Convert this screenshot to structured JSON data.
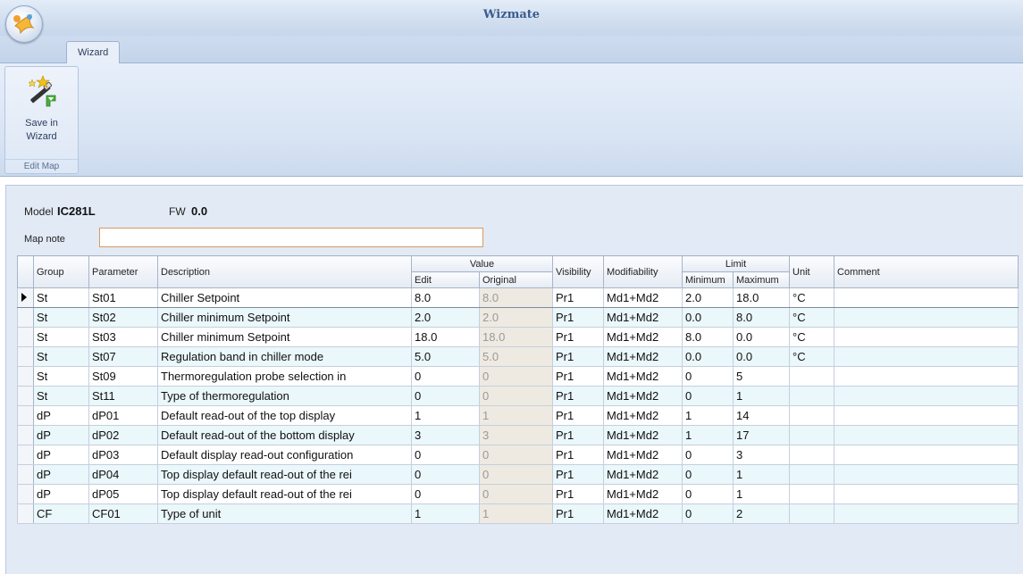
{
  "window": {
    "title": "Wizmate"
  },
  "ribbon": {
    "tabs": [
      "Wizard"
    ],
    "save_button": {
      "label_line1": "Save in",
      "label_line2": "Wizard",
      "icon": "magic-wand-icon"
    },
    "group_label": "Edit Map"
  },
  "info": {
    "model_label": "Model",
    "model_value": "IC281L",
    "fw_label": "FW",
    "fw_value": "0.0",
    "map_note_label": "Map note",
    "map_note_value": ""
  },
  "grid": {
    "headers": {
      "group": "Group",
      "parameter": "Parameter",
      "description": "Description",
      "value": "Value",
      "edit": "Edit",
      "original": "Original",
      "visibility": "Visibility",
      "modifiability": "Modifiability",
      "limit": "Limit",
      "minimum": "Minimum",
      "maximum": "Maximum",
      "unit": "Unit",
      "comment": "Comment"
    },
    "rows": [
      {
        "group": "St",
        "parameter": "St01",
        "description": "Chiller Setpoint",
        "edit": "8.0",
        "original": "8.0",
        "visibility": "Pr1",
        "modifiability": "Md1+Md2",
        "minimum": "2.0",
        "maximum": "18.0",
        "unit": "°C",
        "comment": ""
      },
      {
        "group": "St",
        "parameter": "St02",
        "description": "Chiller minimum Setpoint",
        "edit": "2.0",
        "original": "2.0",
        "visibility": "Pr1",
        "modifiability": "Md1+Md2",
        "minimum": "0.0",
        "maximum": "8.0",
        "unit": "°C",
        "comment": ""
      },
      {
        "group": "St",
        "parameter": "St03",
        "description": "Chiller minimum Setpoint",
        "edit": "18.0",
        "original": "18.0",
        "visibility": "Pr1",
        "modifiability": "Md1+Md2",
        "minimum": "8.0",
        "maximum": "0.0",
        "unit": "°C",
        "comment": ""
      },
      {
        "group": "St",
        "parameter": "St07",
        "description": "Regulation band in chiller mode",
        "edit": "5.0",
        "original": "5.0",
        "visibility": "Pr1",
        "modifiability": "Md1+Md2",
        "minimum": "0.0",
        "maximum": "0.0",
        "unit": "°C",
        "comment": ""
      },
      {
        "group": "St",
        "parameter": "St09",
        "description": "Thermoregulation probe selection  in",
        "edit": "0",
        "original": "0",
        "visibility": "Pr1",
        "modifiability": "Md1+Md2",
        "minimum": "0",
        "maximum": "5",
        "unit": "",
        "comment": ""
      },
      {
        "group": "St",
        "parameter": "St11",
        "description": "Type of thermoregulation",
        "edit": "0",
        "original": "0",
        "visibility": "Pr1",
        "modifiability": "Md1+Md2",
        "minimum": "0",
        "maximum": "1",
        "unit": "",
        "comment": ""
      },
      {
        "group": "dP",
        "parameter": "dP01",
        "description": "Default read-out of the top display",
        "edit": "1",
        "original": "1",
        "visibility": "Pr1",
        "modifiability": "Md1+Md2",
        "minimum": "1",
        "maximum": "14",
        "unit": "",
        "comment": ""
      },
      {
        "group": "dP",
        "parameter": "dP02",
        "description": "Default read-out of the bottom display",
        "edit": "3",
        "original": "3",
        "visibility": "Pr1",
        "modifiability": "Md1+Md2",
        "minimum": "1",
        "maximum": "17",
        "unit": "",
        "comment": ""
      },
      {
        "group": "dP",
        "parameter": "dP03",
        "description": "Default display read-out configuration",
        "edit": "0",
        "original": "0",
        "visibility": "Pr1",
        "modifiability": "Md1+Md2",
        "minimum": "0",
        "maximum": "3",
        "unit": "",
        "comment": ""
      },
      {
        "group": "dP",
        "parameter": "dP04",
        "description": "Top display default read-out of the rei",
        "edit": "0",
        "original": "0",
        "visibility": "Pr1",
        "modifiability": "Md1+Md2",
        "minimum": "0",
        "maximum": "1",
        "unit": "",
        "comment": ""
      },
      {
        "group": "dP",
        "parameter": "dP05",
        "description": "Top display default read-out of the rei",
        "edit": "0",
        "original": "0",
        "visibility": "Pr1",
        "modifiability": "Md1+Md2",
        "minimum": "0",
        "maximum": "1",
        "unit": "",
        "comment": ""
      },
      {
        "group": "CF",
        "parameter": "CF01",
        "description": "Type of unit",
        "edit": "1",
        "original": "1",
        "visibility": "Pr1",
        "modifiability": "Md1+Md2",
        "minimum": "0",
        "maximum": "2",
        "unit": "",
        "comment": ""
      }
    ],
    "selected_row": 0
  }
}
